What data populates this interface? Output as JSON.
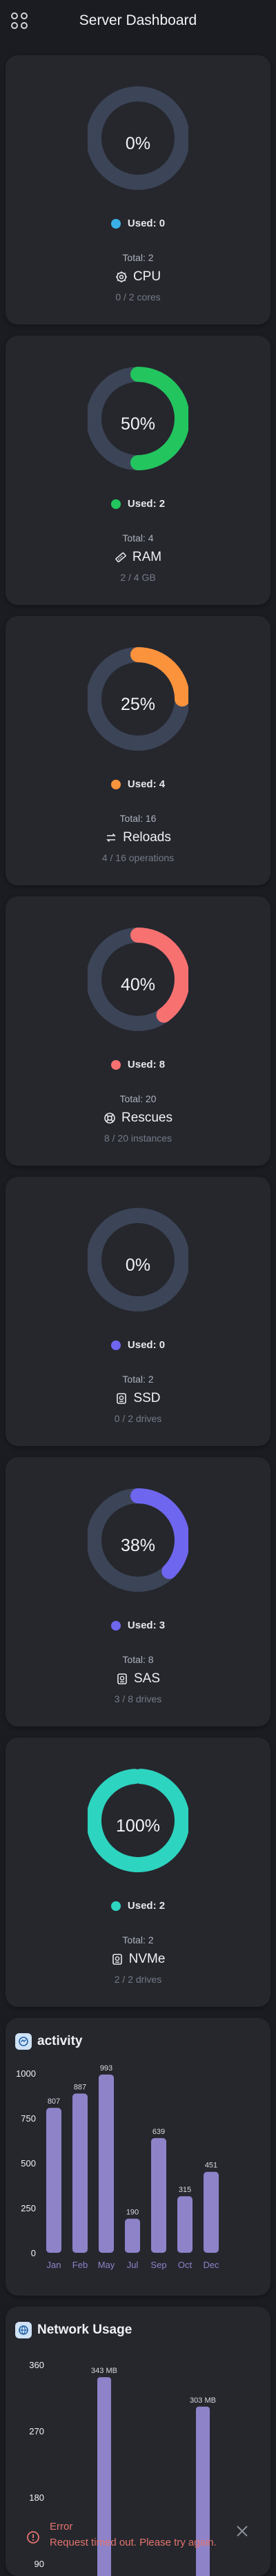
{
  "header": {
    "title": "Server Dashboard",
    "menu_icon": "apps-grid-icon"
  },
  "colors": {
    "track": "#3c4457",
    "cpu": "#3ab0e8",
    "ram": "#22c55e",
    "reloads": "#fb923c",
    "rescues": "#f87171",
    "ssd": "#6e66ef",
    "sas": "#6e66ef",
    "nvme": "#2dd4bf",
    "bar": "#8e83c9"
  },
  "metrics": [
    {
      "key": "cpu",
      "percent": "0%",
      "fraction": 0,
      "used": "Used:  0",
      "total": "Total:  2",
      "name": "CPU",
      "icon": "cpu-icon",
      "sub": "0 / 2 cores",
      "color": "#3ab0e8"
    },
    {
      "key": "ram",
      "percent": "50%",
      "fraction": 0.5,
      "used": "Used:  2",
      "total": "Total:  4",
      "name": "RAM",
      "icon": "memory-icon",
      "sub": "2 / 4 GB",
      "color": "#22c55e"
    },
    {
      "key": "reloads",
      "percent": "25%",
      "fraction": 0.25,
      "used": "Used:  4",
      "total": "Total:  16",
      "name": "Reloads",
      "icon": "reload-icon",
      "sub": "4 / 16 operations",
      "color": "#fb923c"
    },
    {
      "key": "rescues",
      "percent": "40%",
      "fraction": 0.4,
      "used": "Used:  8",
      "total": "Total:  20",
      "name": "Rescues",
      "icon": "lifebuoy-icon",
      "sub": "8 / 20 instances",
      "color": "#f87171"
    },
    {
      "key": "ssd",
      "percent": "0%",
      "fraction": 0,
      "used": "Used:  0",
      "total": "Total:  2",
      "name": "SSD",
      "icon": "drive-icon",
      "sub": "0 / 2 drives",
      "color": "#6e66ef"
    },
    {
      "key": "sas",
      "percent": "38%",
      "fraction": 0.375,
      "used": "Used:  3",
      "total": "Total:  8",
      "name": "SAS",
      "icon": "drive-icon",
      "sub": "3 / 8 drives",
      "color": "#6e66ef"
    },
    {
      "key": "nvme",
      "percent": "100%",
      "fraction": 1,
      "used": "Used:  2",
      "total": "Total:  2",
      "name": "NVMe",
      "icon": "drive-icon",
      "sub": "2 / 2 drives",
      "color": "#2dd4bf"
    }
  ],
  "activity": {
    "title": "activity",
    "icon": "activity-icon"
  },
  "network": {
    "title": "Network Usage",
    "icon": "network-icon"
  },
  "chart_data": [
    {
      "type": "bar",
      "title": "activity",
      "categories": [
        "Jan",
        "Feb",
        "May",
        "Jul",
        "Sep",
        "Oct",
        "Dec"
      ],
      "values": [
        807,
        887,
        993,
        190,
        639,
        315,
        451
      ],
      "value_labels": [
        "807",
        "887",
        "993",
        "190",
        "639",
        "315",
        "451"
      ],
      "yticks": [
        "1000",
        "750",
        "500",
        "250",
        "0"
      ],
      "ylim": [
        0,
        1000
      ],
      "grid": false
    },
    {
      "type": "bar",
      "title": "Network Usage",
      "values": [
        343,
        303
      ],
      "value_labels": [
        "343 MB",
        "303 MB"
      ],
      "yticks": [
        "360",
        "270",
        "180",
        "90"
      ],
      "ylim": [
        0,
        360
      ],
      "grid": false
    }
  ],
  "toast": {
    "title": "Error",
    "message": "Request timed out. Please try again.",
    "icon": "error-icon",
    "close_icon": "close-icon"
  }
}
